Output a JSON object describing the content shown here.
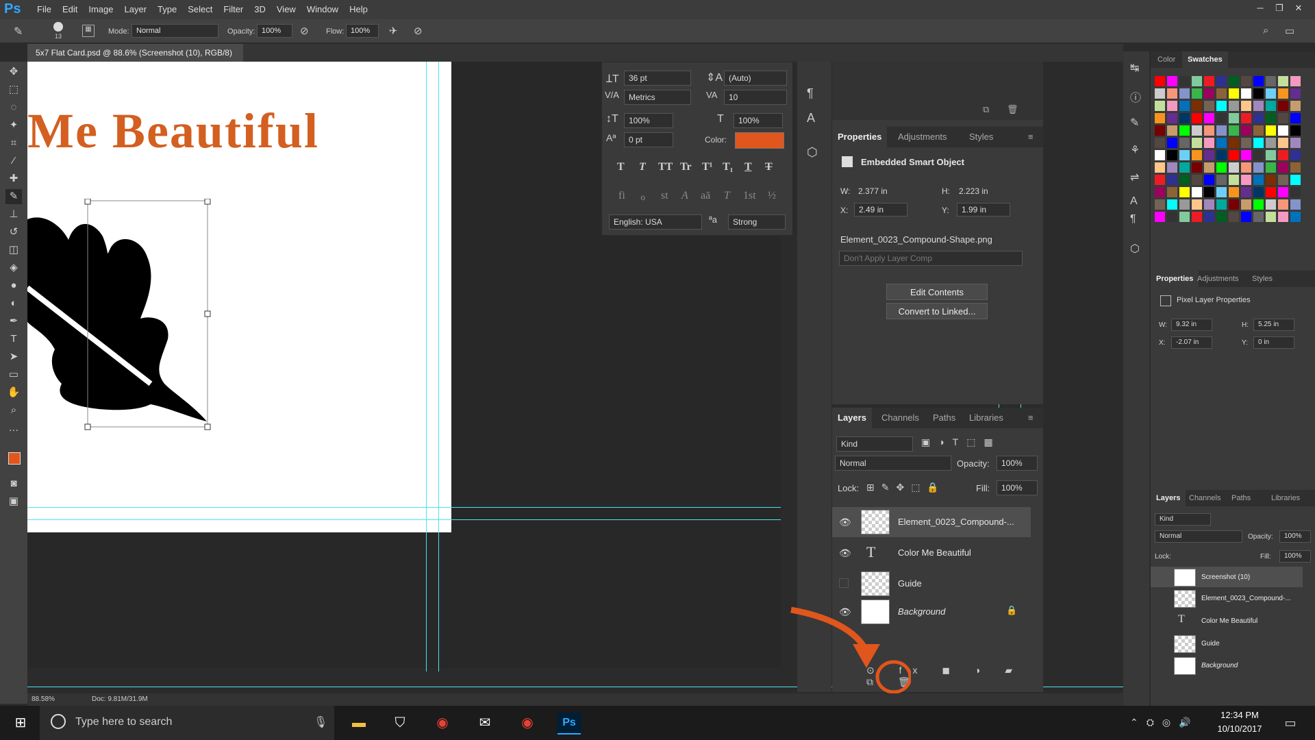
{
  "app": {
    "logo": "Ps"
  },
  "menu": [
    "File",
    "Edit",
    "Image",
    "Layer",
    "Type",
    "Select",
    "Filter",
    "3D",
    "View",
    "Window",
    "Help"
  ],
  "options_bar": {
    "brush_size": "13",
    "mode_label": "Mode:",
    "mode_value": "Normal",
    "opacity_label": "Opacity:",
    "opacity_value": "100%",
    "flow_label": "Flow:",
    "flow_value": "100%"
  },
  "document": {
    "tab_title": "5x7 Flat Card.psd @ 88.6% (Screenshot (10), RGB/8) *",
    "heading_text": "Me Beautiful",
    "zoom": "88.58%",
    "doc_size": "Doc: 9.81M/31.9M"
  },
  "character_panel": {
    "font_size": "36 pt",
    "leading": "(Auto)",
    "kerning": "Metrics",
    "tracking": "10",
    "vscale": "100%",
    "hscale": "100%",
    "baseline": "0 pt",
    "color_label": "Color:",
    "color_value": "#e0561c",
    "language": "English: USA",
    "antialias_icon": "aa-icon",
    "antialias": "Strong",
    "style_glyphs": [
      "T",
      "T",
      "TT",
      "Tr",
      "T¹",
      "T₁",
      "T",
      "T"
    ],
    "opentype_glyphs": [
      "fi",
      "ℴ",
      "st",
      "A",
      "aā",
      "T",
      "1st",
      "½"
    ]
  },
  "properties_panel": {
    "tabs": [
      "Properties",
      "Adjustments",
      "Styles"
    ],
    "type": "Embedded Smart Object",
    "w_label": "W:",
    "w": "2.377 in",
    "h_label": "H:",
    "h": "2.223 in",
    "x_label": "X:",
    "x": "2.49 in",
    "y_label": "Y:",
    "y": "1.99 in",
    "filename": "Element_0023_Compound-Shape.png",
    "layer_comp": "Don't Apply Layer Comp",
    "edit_button": "Edit Contents",
    "convert_button": "Convert to Linked..."
  },
  "layers_panel": {
    "tabs": [
      "Layers",
      "Channels",
      "Paths",
      "Libraries"
    ],
    "filter_kind": "Kind",
    "blend_mode": "Normal",
    "opacity_label": "Opacity:",
    "opacity": "100%",
    "lock_label": "Lock:",
    "fill_label": "Fill:",
    "fill": "100%",
    "layers": [
      {
        "name": "Element_0023_Compound-...",
        "type": "smart"
      },
      {
        "name": "Color Me Beautiful",
        "type": "text"
      },
      {
        "name": "Guide",
        "type": "pixel"
      },
      {
        "name": "Background",
        "type": "background"
      }
    ]
  },
  "right_panels": {
    "color_tabs": [
      "Color",
      "Swatches"
    ],
    "props_tabs": [
      "Properties",
      "Adjustments",
      "Styles"
    ],
    "pixel_props": "Pixel Layer Properties",
    "w_label": "W:",
    "w": "9.32 in",
    "h_label": "H:",
    "h": "5.25 in",
    "x_label": "X:",
    "x": "-2.07 in",
    "y_label": "Y:",
    "y": "0 in",
    "layers_tabs": [
      "Layers",
      "Channels",
      "Paths",
      "Libraries"
    ],
    "filter_kind": "Kind",
    "blend_mode": "Normal",
    "opacity_label": "Opacity:",
    "opacity": "100%",
    "lock_label": "Lock:",
    "fill_label": "Fill:",
    "fill": "100%",
    "layers": [
      {
        "name": "Screenshot (10)"
      },
      {
        "name": "Element_0023_Compound-..."
      },
      {
        "name": "Color Me Beautiful"
      },
      {
        "name": "Guide"
      },
      {
        "name": "Background"
      }
    ]
  },
  "taskbar": {
    "search_placeholder": "Type here to search",
    "time": "12:34 PM",
    "date": "10/10/2017"
  },
  "colors": {
    "accent": "#e0561c",
    "guide": "#4fe3ef",
    "ps_blue": "#31a8ff"
  }
}
